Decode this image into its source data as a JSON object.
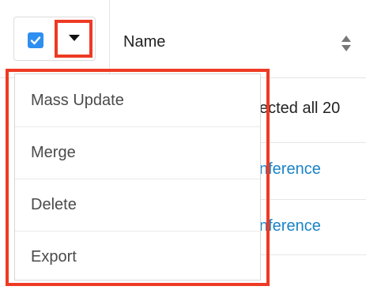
{
  "header": {
    "select_all_checked": true,
    "name_column_label": "Name",
    "sort_icon": "sort-both-icon",
    "dropdown_icon": "caret-down-icon"
  },
  "rows": [
    {
      "text": "ected all 20",
      "link": false
    },
    {
      "text": "nference",
      "link": true
    },
    {
      "text": "nference",
      "link": true
    }
  ],
  "mass_actions_menu": {
    "items": [
      "Mass Update",
      "Merge",
      "Delete",
      "Export"
    ]
  },
  "colors": {
    "highlight": "#ee3a24",
    "checkbox": "#2f8ff0",
    "link": "#1b83c6"
  }
}
